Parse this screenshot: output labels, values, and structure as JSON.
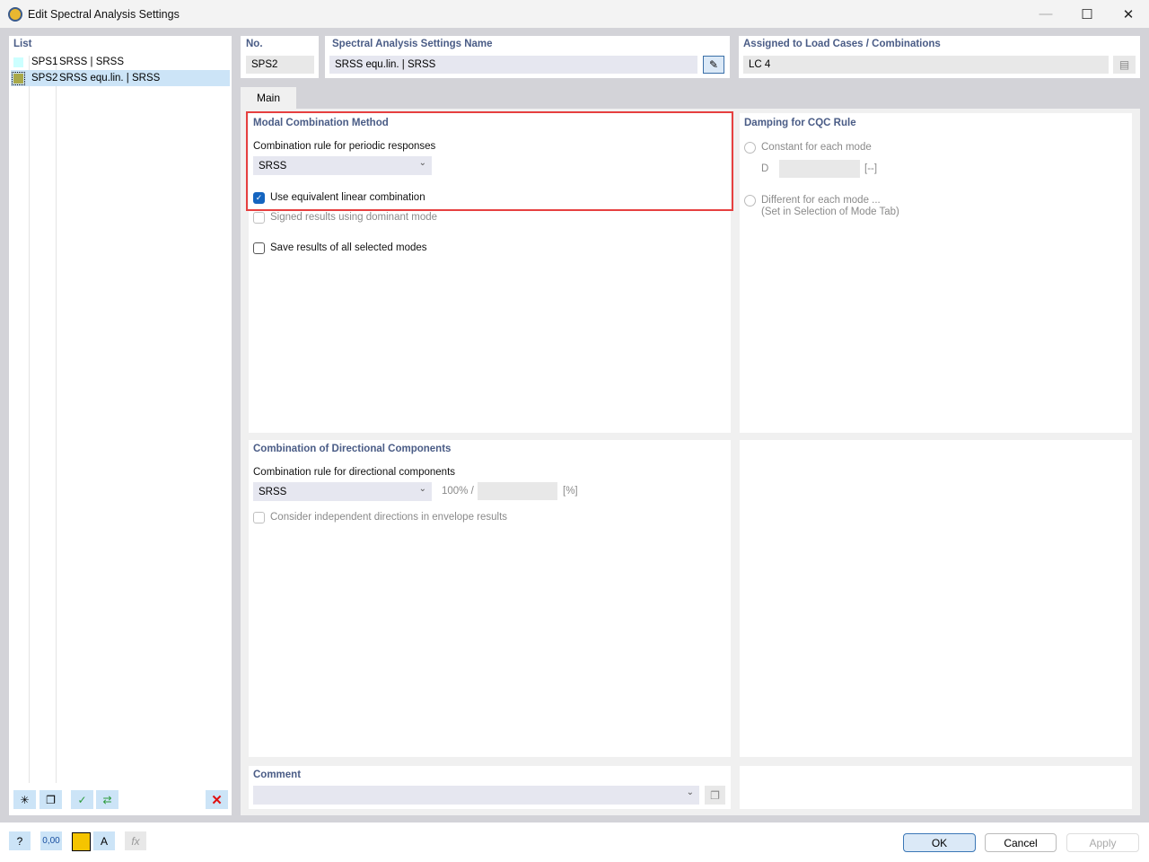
{
  "window": {
    "title": "Edit Spectral Analysis Settings"
  },
  "list": {
    "title": "List",
    "items": [
      {
        "id": "SPS1",
        "name": "SRSS | SRSS",
        "color": "#ccffff",
        "selected": false
      },
      {
        "id": "SPS2",
        "name": "SRSS equ.lin. | SRSS",
        "color": "#a9a94a",
        "selected": true
      }
    ]
  },
  "header": {
    "no_label": "No.",
    "no_value": "SPS2",
    "name_label": "Spectral Analysis Settings Name",
    "name_value": "SRSS equ.lin. | SRSS",
    "assigned_label": "Assigned to Load Cases / Combinations",
    "assigned_value": "LC 4"
  },
  "tabs": [
    {
      "label": "Main",
      "active": true
    }
  ],
  "modal": {
    "title": "Modal Combination Method",
    "rule_label": "Combination rule for periodic responses",
    "rule_value": "SRSS",
    "equiv_linear_label": "Use equivalent linear combination",
    "equiv_linear_checked": true,
    "signed_label": "Signed results using dominant mode",
    "signed_checked": false,
    "save_label": "Save results of all selected modes",
    "save_checked": false
  },
  "damping": {
    "title": "Damping for CQC Rule",
    "constant_label": "Constant for each mode",
    "d_label": "D",
    "d_value": "",
    "d_unit": "[--]",
    "different_label": "Different for each mode ...",
    "different_sub": "(Set in Selection of Mode Tab)"
  },
  "directional": {
    "title": "Combination of Directional Components",
    "rule_label": "Combination rule for directional components",
    "rule_value": "SRSS",
    "percent_prefix": "100% /",
    "percent_value": "",
    "percent_unit": "[%]",
    "independent_label": "Consider independent directions in envelope results",
    "independent_checked": false
  },
  "comment": {
    "title": "Comment",
    "value": ""
  },
  "buttons": {
    "ok": "OK",
    "cancel": "Cancel",
    "apply": "Apply"
  },
  "bottom_tools": {
    "color_swatch": "#f5c400",
    "units_label": "0,00"
  }
}
